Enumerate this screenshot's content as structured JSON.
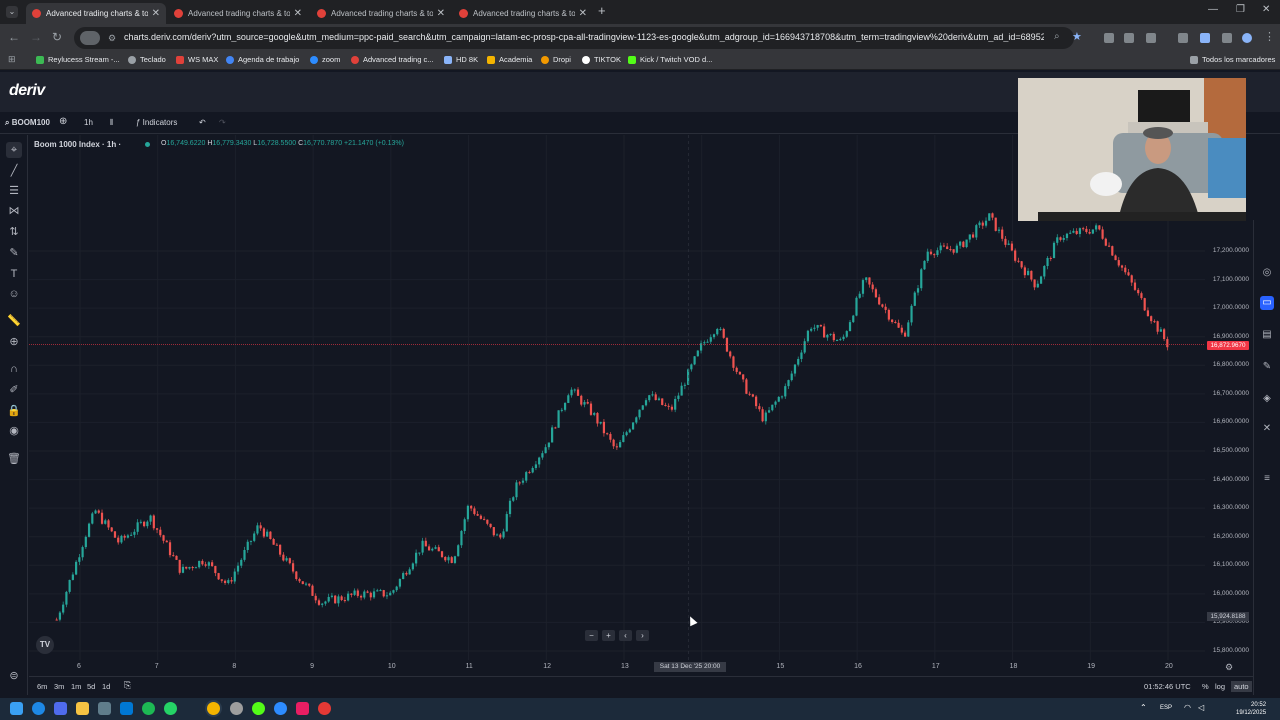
{
  "browser": {
    "tabs": [
      {
        "title": "Advanced trading charts & too",
        "active": true
      },
      {
        "title": "Advanced trading charts & too",
        "active": false
      },
      {
        "title": "Advanced trading charts & too",
        "active": false
      },
      {
        "title": "Advanced trading charts & too",
        "active": false
      }
    ],
    "url": "charts.deriv.com/deriv?utm_source=google&utm_medium=ppc-paid_search&utm_campaign=latam-ec-prosp-cpa-all-tradingview-1123-es-google&utm_adgroup_id=166943718708&utm_term=tradingview%20deriv&utm_ad_id=6895218844068...",
    "bookmarks": [
      {
        "label": "Reylucess Stream -...",
        "color": "#3cba54"
      },
      {
        "label": "Teclado",
        "color": "#9aa0a6"
      },
      {
        "label": "WS MAX",
        "color": "#e0413a"
      },
      {
        "label": "Agenda de trabajo",
        "color": "#4285f4"
      },
      {
        "label": "zoom",
        "color": "#2d8cff"
      },
      {
        "label": "Advanced trading c...",
        "color": "#e0413a"
      },
      {
        "label": "HD 8K",
        "color": "#8ab4f8"
      },
      {
        "label": "Academia",
        "color": "#f4b400"
      },
      {
        "label": "Dropi",
        "color": "#f29900"
      },
      {
        "label": "TIKTOK",
        "color": "#ffffff"
      },
      {
        "label": "Kick / Twitch VOD d...",
        "color": "#53fc18"
      }
    ],
    "all_bookmarks": "Todos los marcadores"
  },
  "app": {
    "logo": "deriv",
    "toolbar": {
      "symbol_search": "BOOM100",
      "interval": "1h",
      "indicators": "Indicators"
    },
    "legend": {
      "symbol": "Boom 1000 Index · 1h ·",
      "ohlc": [
        {
          "k": "O",
          "v": "16,749.6220"
        },
        {
          "k": "H",
          "v": "16,779.3430"
        },
        {
          "k": "L",
          "v": "16,728.5500"
        },
        {
          "k": "C",
          "v": "16,770.7870"
        },
        {
          "k": "",
          "v": "+21.1470 (+0.13%)"
        }
      ]
    },
    "price_labels": [
      "17,200.0000",
      "17,100.0000",
      "17,000.0000",
      "16,900.0000",
      "16,800.0000",
      "16,700.0000",
      "16,600.0000",
      "16,500.0000",
      "16,400.0000",
      "16,300.0000",
      "16,200.0000",
      "16,100.0000",
      "16,000.0000",
      "15,900.0000",
      "15,800.0000"
    ],
    "current_price_tag": "16,872.9670",
    "low_price_tag": "15,924.8188",
    "time_labels": [
      "6",
      "7",
      "8",
      "9",
      "10",
      "11",
      "12",
      "13",
      "14",
      "15",
      "16",
      "17",
      "18",
      "19",
      "20"
    ],
    "crosshair_time": "Sat 13 Dec '25   20:00",
    "bottom": {
      "ranges": [
        "6m",
        "3m",
        "1m",
        "5d",
        "1d"
      ],
      "utc_time": "01:52:46 UTC",
      "percent": "%",
      "log": "log",
      "auto": "auto"
    },
    "colors": {
      "up": "#26a69a",
      "down": "#ef5350",
      "price_line": "#f23645"
    }
  },
  "chart_data": {
    "type": "candlestick",
    "title": "Boom 1000 Index · 1h",
    "xlabel": "",
    "ylabel": "",
    "ylim": [
      15780,
      17300
    ],
    "x_range": [
      "6",
      "20"
    ],
    "current_price": 16872.967,
    "lowest_visible_marker": 15924.8188,
    "close_path_approx": [
      {
        "x": "5.7",
        "y": 15910
      },
      {
        "x": "6.1",
        "y": 16230
      },
      {
        "x": "6.2",
        "y": 16290
      },
      {
        "x": "6.5",
        "y": 16180
      },
      {
        "x": "6.9",
        "y": 16270
      },
      {
        "x": "7.3",
        "y": 16080
      },
      {
        "x": "7.6",
        "y": 16120
      },
      {
        "x": "7.9",
        "y": 16030
      },
      {
        "x": "8.3",
        "y": 16240
      },
      {
        "x": "8.8",
        "y": 16060
      },
      {
        "x": "9.1",
        "y": 15970
      },
      {
        "x": "9.6",
        "y": 16000
      },
      {
        "x": "10.0",
        "y": 16000
      },
      {
        "x": "10.4",
        "y": 16170
      },
      {
        "x": "10.8",
        "y": 16120
      },
      {
        "x": "11.0",
        "y": 16310
      },
      {
        "x": "11.4",
        "y": 16190
      },
      {
        "x": "11.6",
        "y": 16370
      },
      {
        "x": "12.0",
        "y": 16520
      },
      {
        "x": "12.3",
        "y": 16720
      },
      {
        "x": "12.6",
        "y": 16630
      },
      {
        "x": "12.9",
        "y": 16500
      },
      {
        "x": "13.3",
        "y": 16700
      },
      {
        "x": "13.6",
        "y": 16640
      },
      {
        "x": "14.0",
        "y": 16870
      },
      {
        "x": "14.2",
        "y": 16940
      },
      {
        "x": "14.5",
        "y": 16750
      },
      {
        "x": "14.8",
        "y": 16610
      },
      {
        "x": "15.1",
        "y": 16730
      },
      {
        "x": "15.4",
        "y": 16940
      },
      {
        "x": "15.8",
        "y": 16880
      },
      {
        "x": "16.1",
        "y": 17100
      },
      {
        "x": "16.6",
        "y": 16900
      },
      {
        "x": "16.9",
        "y": 17200
      },
      {
        "x": "17.3",
        "y": 17210
      },
      {
        "x": "17.7",
        "y": 17320
      },
      {
        "x": "18.0",
        "y": 17190
      },
      {
        "x": "18.3",
        "y": 17080
      },
      {
        "x": "18.6",
        "y": 17250
      },
      {
        "x": "19.1",
        "y": 17280
      },
      {
        "x": "19.5",
        "y": 17100
      },
      {
        "x": "19.8",
        "y": 16960
      },
      {
        "x": "20.0",
        "y": 16870
      }
    ]
  },
  "taskbar": {
    "lang": "ESP",
    "time": "20:52",
    "date": "19/12/2025"
  }
}
